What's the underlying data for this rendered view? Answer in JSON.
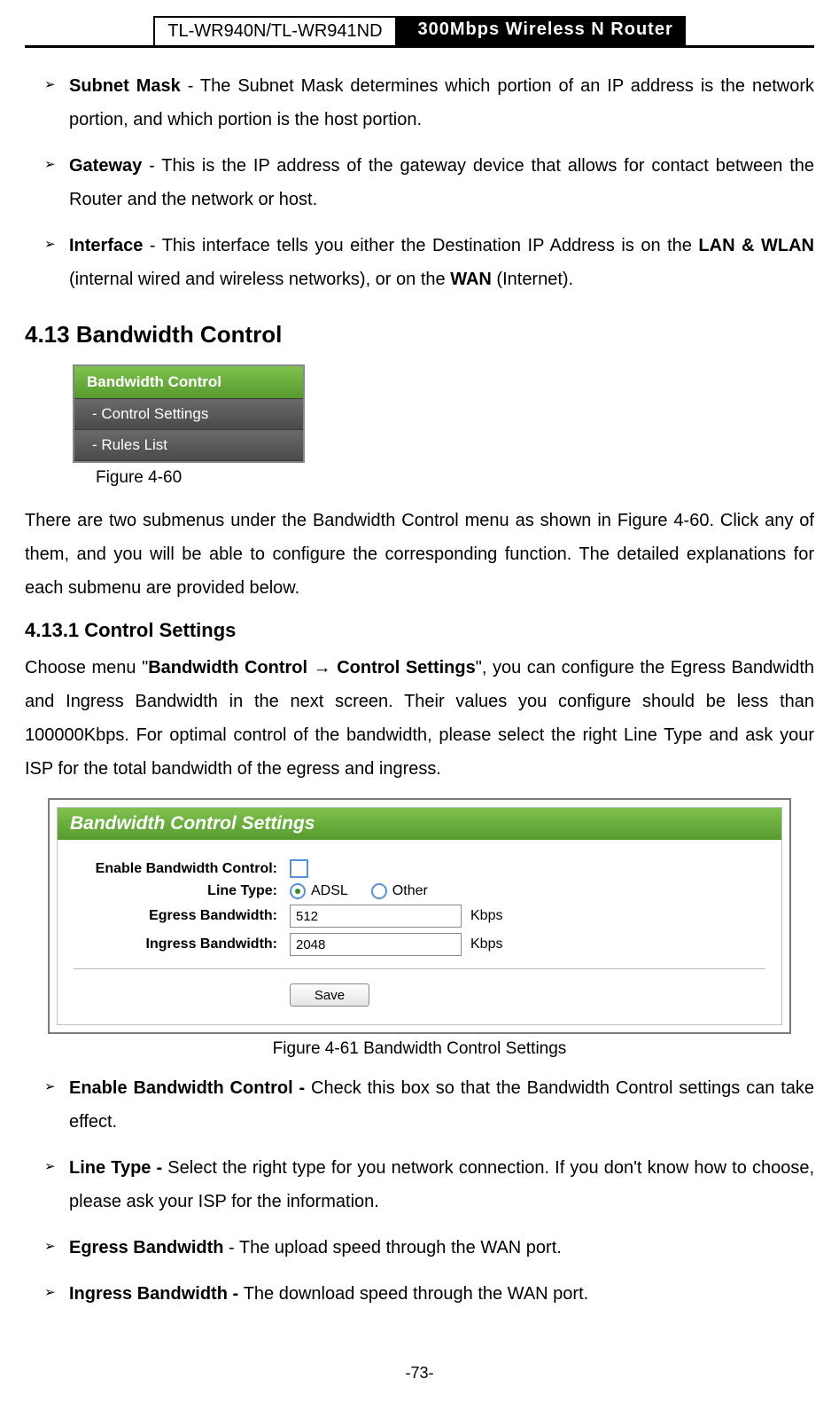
{
  "header": {
    "model": "TL-WR940N/TL-WR941ND",
    "product": "300Mbps Wireless N Router"
  },
  "bullets_top": [
    {
      "term": "Subnet Mask",
      "text": " - The Subnet Mask determines which portion of an IP address is the network portion, and which portion is the host portion."
    },
    {
      "term": "Gateway",
      "text": " - This is the IP address of the gateway device that allows for contact between the Router and the network or host."
    },
    {
      "term": "Interface",
      "text_before": " - This interface tells you either the Destination IP Address is on the ",
      "b1": "LAN & WLAN",
      "mid": " (internal wired and wireless networks), or on the ",
      "b2": "WAN",
      "after": " (Internet)."
    }
  ],
  "section": "4.13  Bandwidth Control",
  "menu": {
    "title": "Bandwidth Control",
    "items": [
      "- Control Settings",
      "- Rules List"
    ]
  },
  "fig60": "Figure 4-60",
  "para1": "There are two submenus under the Bandwidth Control menu as shown in Figure 4-60. Click any of them, and you will be able to configure the corresponding function. The detailed explanations for each submenu are provided below.",
  "sub": "4.13.1 Control Settings",
  "para2_parts": {
    "p1": "Choose menu \"",
    "b1": "Bandwidth Control → Control Settings",
    "p2": "\", you can configure the Egress Bandwidth and Ingress Bandwidth in the next screen. Their values you configure should be less than 100000Kbps. For optimal control of the bandwidth, please select the right Line Type and ask your ISP for the total bandwidth of the egress and ingress."
  },
  "panel": {
    "title": "Bandwidth Control Settings",
    "labels": {
      "enable": "Enable Bandwidth Control:",
      "line": "Line Type:",
      "egress": "Egress Bandwidth:",
      "ingress": "Ingress Bandwidth:"
    },
    "radios": {
      "adsl": "ADSL",
      "other": "Other"
    },
    "values": {
      "egress": "512",
      "ingress": "2048"
    },
    "unit": "Kbps",
    "save": "Save"
  },
  "fig61": "Figure 4-61 Bandwidth Control Settings",
  "bullets_bottom": [
    {
      "term": "Enable Bandwidth Control - ",
      "text": "Check this box so that the Bandwidth Control settings can take effect."
    },
    {
      "term": "Line Type - ",
      "text": "Select the right type for you network connection. If you don't know how to choose, please ask your ISP for the information."
    },
    {
      "term": "Egress Bandwidth",
      "text": " - The upload speed through the WAN port."
    },
    {
      "term": "Ingress Bandwidth - ",
      "text": "The download speed through the WAN port."
    }
  ],
  "page_num": "-73-"
}
